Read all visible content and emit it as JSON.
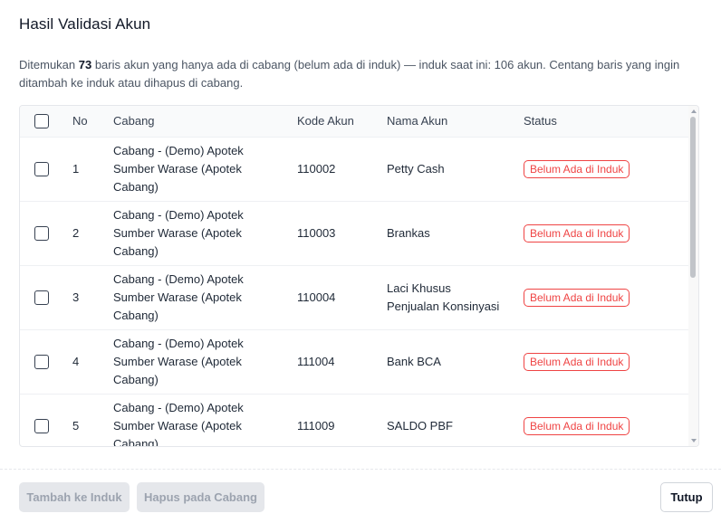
{
  "modal": {
    "title": "Hasil Validasi Akun",
    "description": {
      "before": "Ditemukan ",
      "count": "73",
      "after": " baris akun yang hanya ada di cabang (belum ada di induk) — induk saat ini: 106 akun. Centang baris yang ingin ditambah ke induk atau dihapus di cabang."
    }
  },
  "table": {
    "headers": {
      "no": "No",
      "cabang": "Cabang",
      "kode": "Kode Akun",
      "nama": "Nama Akun",
      "status": "Status"
    },
    "rows": [
      {
        "no": "1",
        "cabang": "Cabang - (Demo) Apotek Sumber Warase (Apotek Cabang)",
        "kode": "110002",
        "nama": "Petty Cash",
        "status": "Belum Ada di Induk"
      },
      {
        "no": "2",
        "cabang": "Cabang - (Demo) Apotek Sumber Warase (Apotek Cabang)",
        "kode": "110003",
        "nama": "Brankas",
        "status": "Belum Ada di Induk"
      },
      {
        "no": "3",
        "cabang": "Cabang - (Demo) Apotek Sumber Warase (Apotek Cabang)",
        "kode": "110004",
        "nama": "Laci Khusus Penjualan Konsinyasi",
        "status": "Belum Ada di Induk"
      },
      {
        "no": "4",
        "cabang": "Cabang - (Demo) Apotek Sumber Warase (Apotek Cabang)",
        "kode": "111004",
        "nama": "Bank BCA",
        "status": "Belum Ada di Induk"
      },
      {
        "no": "5",
        "cabang": "Cabang - (Demo) Apotek Sumber Warase (Apotek Cabang)",
        "kode": "111009",
        "nama": "SALDO PBF",
        "status": "Belum Ada di Induk"
      }
    ]
  },
  "footer": {
    "add_label": "Tambah ke Induk",
    "delete_label": "Hapus pada Cabang",
    "close_label": "Tutup"
  },
  "colors": {
    "status_badge": "#ef4444",
    "disabled_button_bg": "#e5e7eb"
  }
}
